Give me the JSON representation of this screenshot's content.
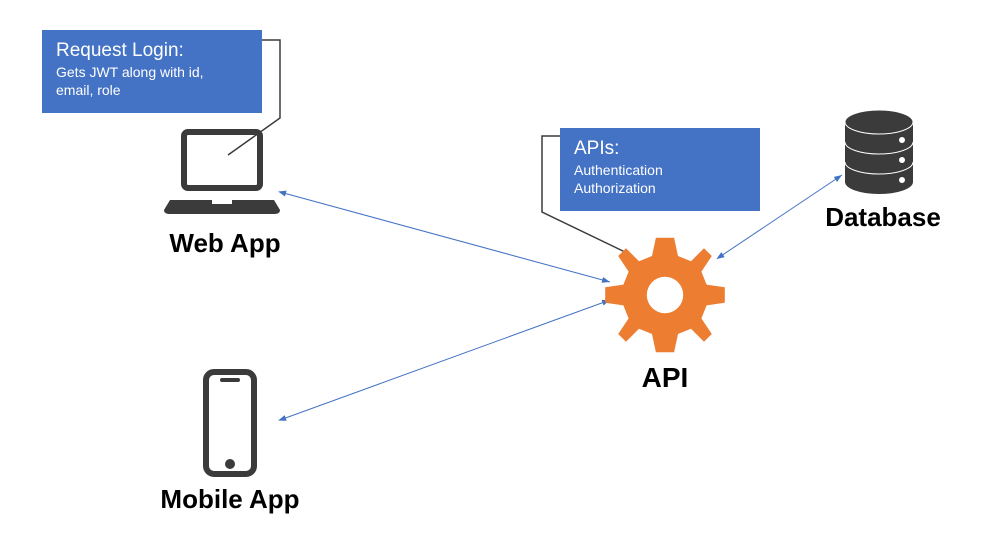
{
  "diagram": {
    "webApp": {
      "label": "Web App"
    },
    "mobileApp": {
      "label": "Mobile App"
    },
    "api": {
      "label": "API"
    },
    "database": {
      "label": "Database"
    },
    "calloutLogin": {
      "title": "Request Login:",
      "body": "Gets JWT along with id,\nemail, role"
    },
    "calloutApis": {
      "title": "APIs:",
      "body": "Authentication\nAuthorization"
    },
    "colors": {
      "blueBox": "#4472C4",
      "iconDark": "#3B3B3B",
      "gearOrange": "#ED7D31",
      "arrowBlue": "#4472C4"
    }
  }
}
